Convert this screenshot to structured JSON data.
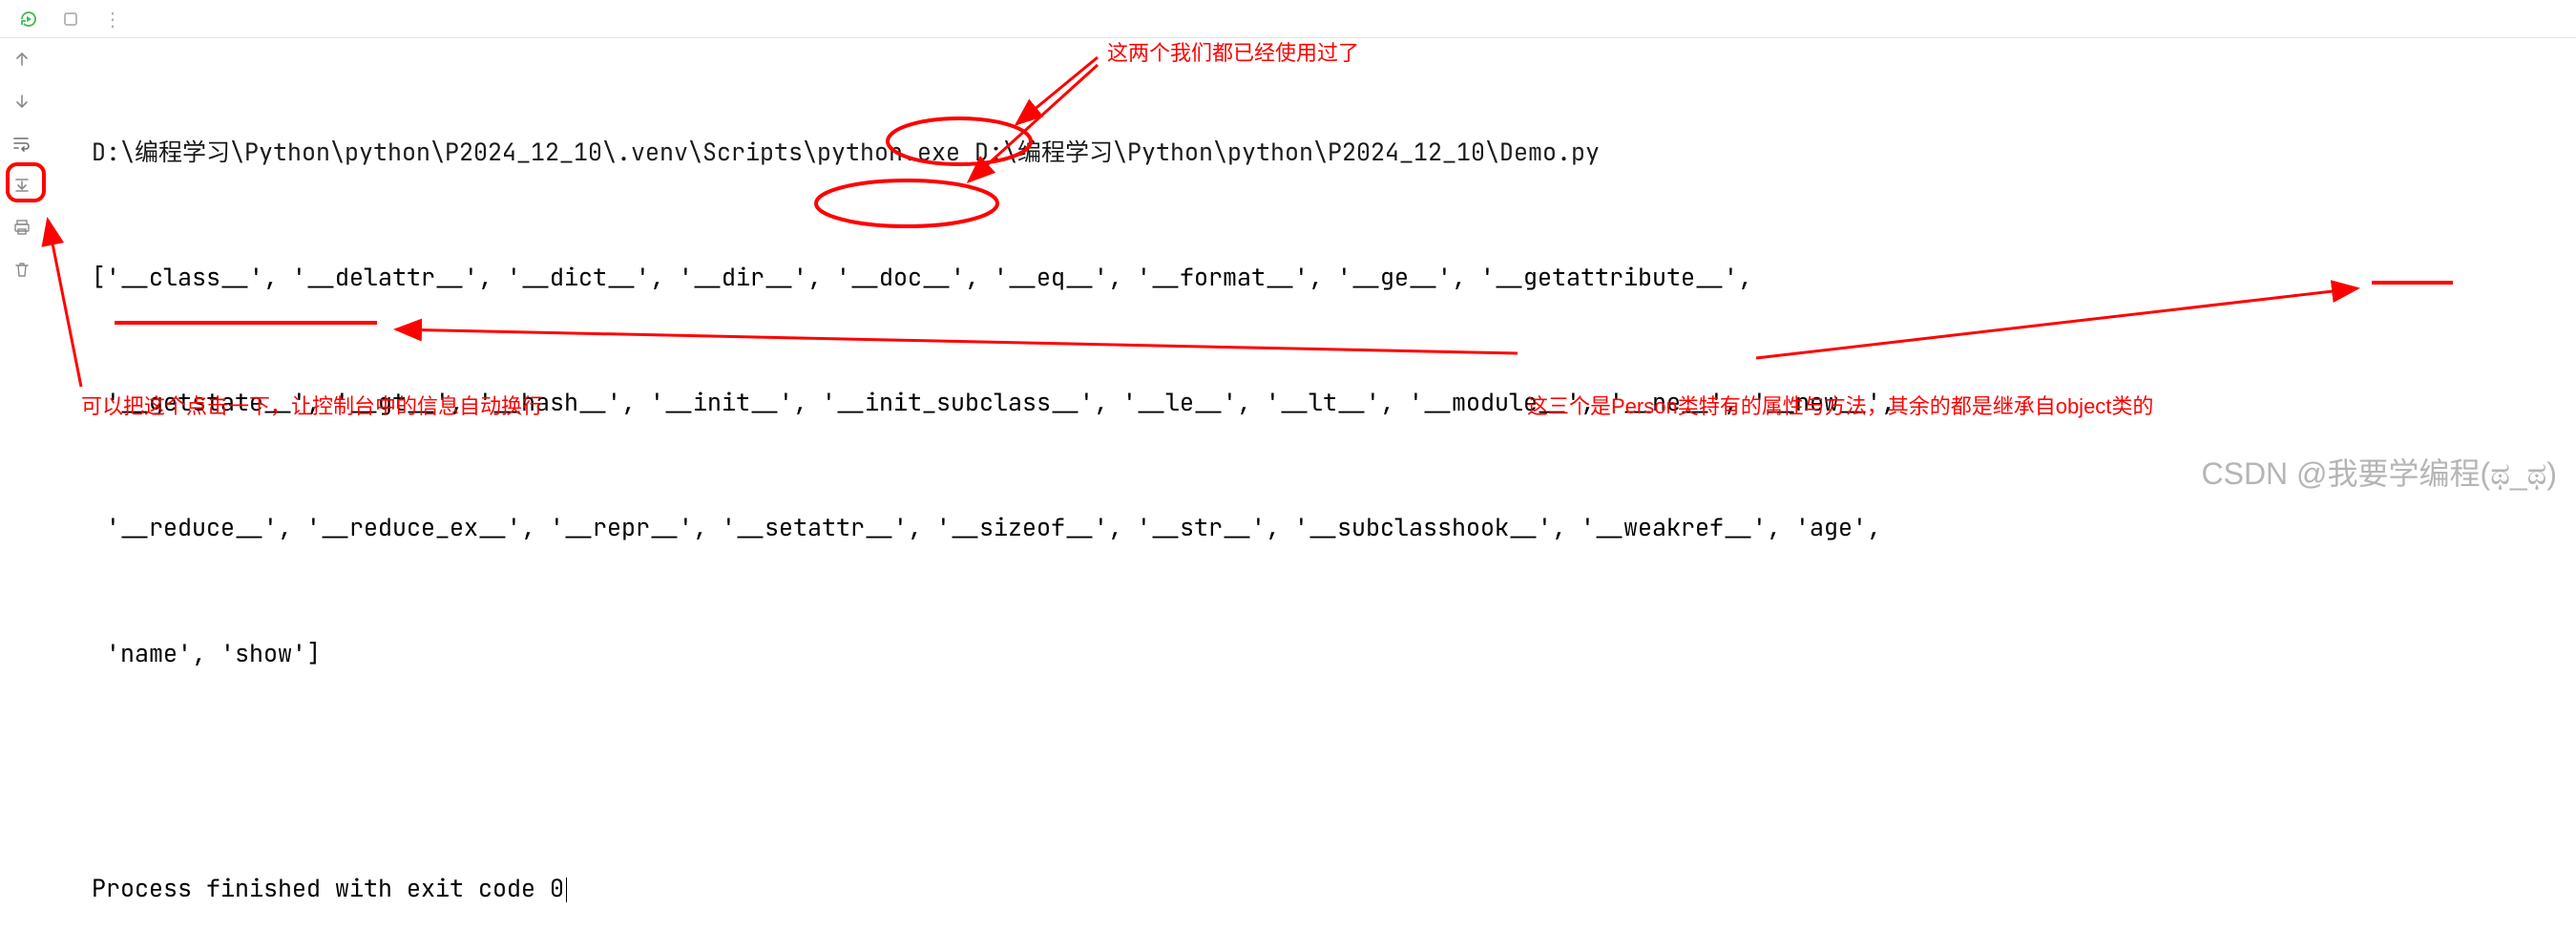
{
  "toolbar": {
    "rerun_icon": "rerun-icon",
    "stop_icon": "stop-icon",
    "more_icon": "more-icon"
  },
  "sidebar": {
    "items": [
      {
        "name": "up-arrow-icon"
      },
      {
        "name": "down-arrow-icon"
      },
      {
        "name": "soft-wrap-icon"
      },
      {
        "name": "scroll-to-end-icon"
      },
      {
        "name": "print-icon"
      },
      {
        "name": "delete-icon"
      }
    ]
  },
  "console": {
    "command": "D:\\编程学习\\Python\\python\\P2024_12_10\\.venv\\Scripts\\python.exe D:\\编程学习\\Python\\python\\P2024_12_10\\Demo.py",
    "output_lines": [
      "['__class__', '__delattr__', '__dict__', '__dir__', '__doc__', '__eq__', '__format__', '__ge__', '__getattribute__',",
      " '__getstate__', '__gt__', '__hash__', '__init__', '__init_subclass__', '__le__', '__lt__', '__module__', '__ne__', '__new__',",
      " '__reduce__', '__reduce_ex__', '__repr__', '__setattr__', '__sizeof__', '__str__', '__subclasshook__', '__weakref__', 'age',",
      " 'name', 'show']"
    ],
    "exit_message": "Process finished with exit code 0"
  },
  "annotations": {
    "top_red": "这两个我们都已经使用过了",
    "left_red": "可以把这个点击一下，让控制台中的信息自动换行",
    "right_red": "这三个是Person类特有的属性与方法，其余的都是继承自object类的"
  },
  "watermark": "CSDN @我要学编程(ಥ_ಥ)"
}
